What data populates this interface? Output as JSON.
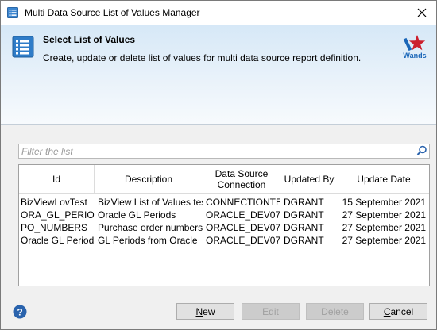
{
  "window": {
    "title": "Multi Data Source List of Values Manager"
  },
  "banner": {
    "title": "Select List of Values",
    "subtitle": "Create, update or delete list of values for multi data source report definition.",
    "logo_text": "Wands",
    "logo_color": "#cc1f2d",
    "logo_text_color": "#1a66b8"
  },
  "search": {
    "placeholder": "Filter the list",
    "value": ""
  },
  "table": {
    "columns": [
      "Id",
      "Description",
      "Data Source Connection",
      "Updated By",
      "Update Date"
    ],
    "column_lines": [
      [
        "Id"
      ],
      [
        "Description"
      ],
      [
        "Data Source",
        "Connection"
      ],
      [
        "Updated By"
      ],
      [
        "Update Date"
      ]
    ],
    "rows": [
      [
        "BizViewLovTest",
        "BizView List of Values test",
        "CONNECTIONTEST",
        "DGRANT",
        "15 September 2021"
      ],
      [
        "ORA_GL_PERIODS",
        "Oracle GL Periods",
        "ORACLE_DEV07",
        "DGRANT",
        "27 September 2021"
      ],
      [
        "PO_NUMBERS",
        "Purchase order numbers",
        "ORACLE_DEV07",
        "DGRANT",
        "27 September 2021"
      ],
      [
        "Oracle GL Period",
        "GL Periods from Oracle",
        "ORACLE_DEV07",
        "DGRANT",
        "27 September 2021"
      ]
    ]
  },
  "buttons": {
    "new": {
      "label": "New",
      "mnemonic": "N",
      "enabled": true
    },
    "edit": {
      "label": "Edit",
      "mnemonic": "E",
      "enabled": false
    },
    "delete": {
      "label": "Delete",
      "mnemonic": "D",
      "enabled": false
    },
    "cancel": {
      "label": "Cancel",
      "mnemonic": "C",
      "enabled": true
    }
  },
  "icons": {
    "app": "list-icon",
    "banner": "list-icon",
    "close": "close-icon",
    "search": "search-icon",
    "help": "help-icon"
  },
  "colors": {
    "accent_blue": "#1e73be",
    "help_blue": "#2a63ad"
  }
}
